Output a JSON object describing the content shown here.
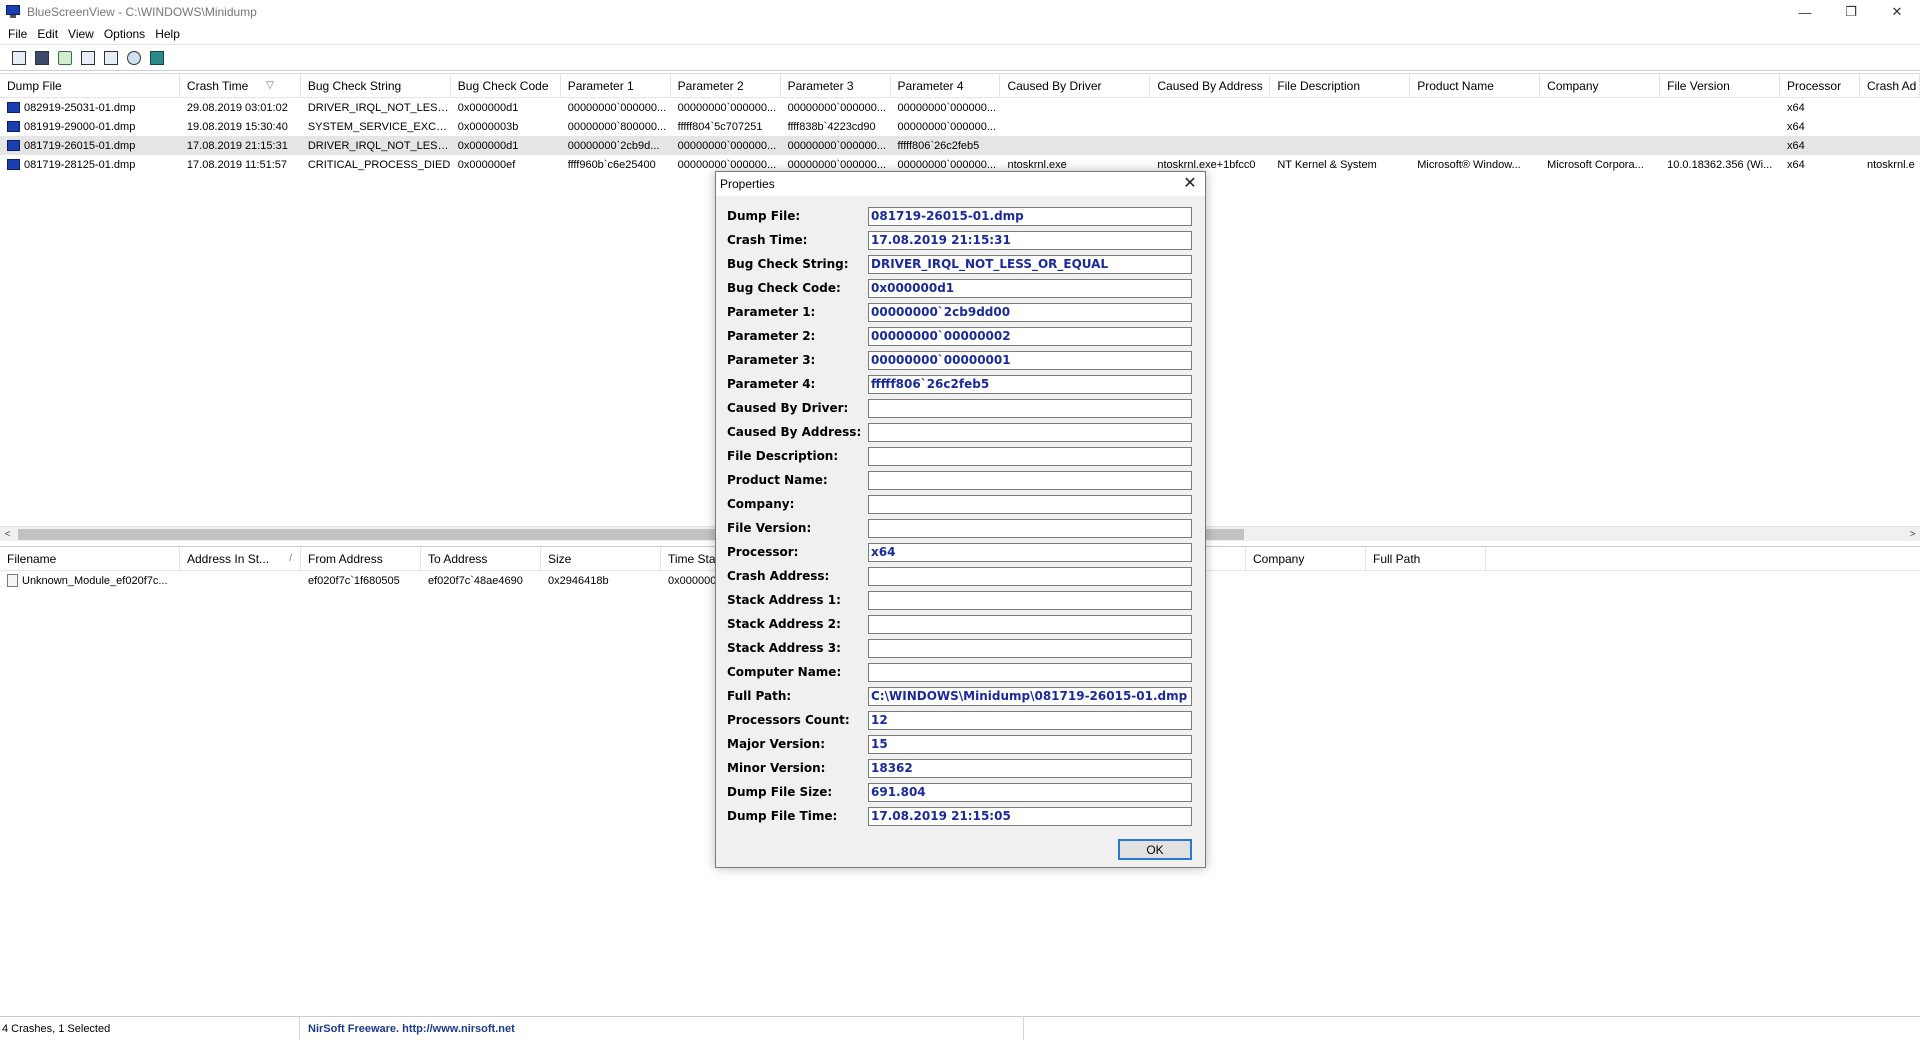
{
  "window": {
    "title": "BlueScreenView  -  C:\\WINDOWS\\Minidump",
    "minimize": "—",
    "restore": "❐",
    "close": "✕"
  },
  "menu": [
    "File",
    "Edit",
    "View",
    "Options",
    "Help"
  ],
  "toolbar_icons": [
    "properties-icon",
    "save-icon",
    "refresh-icon",
    "copy-icon",
    "html-report-icon",
    "find-icon",
    "exit-icon"
  ],
  "top_grid": {
    "columns": [
      "Dump File",
      "Crash Time",
      "Bug Check String",
      "Bug Check Code",
      "Parameter 1",
      "Parameter 2",
      "Parameter 3",
      "Parameter 4",
      "Caused By Driver",
      "Caused By Address",
      "File Description",
      "Product Name",
      "Company",
      "File Version",
      "Processor",
      "Crash Ad"
    ],
    "sort_indicator": "▽",
    "rows": [
      [
        "082919-25031-01.dmp",
        "29.08.2019 03:01:02",
        "DRIVER_IRQL_NOT_LESS...",
        "0x000000d1",
        "00000000`000000...",
        "00000000`000000...",
        "00000000`000000...",
        "00000000`000000...",
        "",
        "",
        "",
        "",
        "",
        "",
        "x64",
        ""
      ],
      [
        "081919-29000-01.dmp",
        "19.08.2019 15:30:40",
        "SYSTEM_SERVICE_EXCEP...",
        "0x0000003b",
        "00000000`800000...",
        "fffff804`5c707251",
        "ffff838b`4223cd90",
        "00000000`000000...",
        "",
        "",
        "",
        "",
        "",
        "",
        "x64",
        ""
      ],
      [
        "081719-26015-01.dmp",
        "17.08.2019 21:15:31",
        "DRIVER_IRQL_NOT_LESS...",
        "0x000000d1",
        "00000000`2cb9d...",
        "00000000`000000...",
        "00000000`000000...",
        "fffff806`26c2feb5",
        "",
        "",
        "",
        "",
        "",
        "",
        "x64",
        ""
      ],
      [
        "081719-28125-01.dmp",
        "17.08.2019 11:51:57",
        "CRITICAL_PROCESS_DIED",
        "0x000000ef",
        "ffff960b`c6e25400",
        "00000000`000000...",
        "00000000`000000...",
        "00000000`000000...",
        "ntoskrnl.exe",
        "ntoskrnl.exe+1bfcc0",
        "NT Kernel & System",
        "Microsoft® Window...",
        "Microsoft Corpora...",
        "10.0.18362.356 (Wi...",
        "x64",
        "ntoskrnl.e"
      ]
    ]
  },
  "scroll": {
    "left": "<",
    "right": ">"
  },
  "bottom_grid": {
    "columns": [
      "Filename",
      "Address In St...",
      "From Address",
      "To Address",
      "Size",
      "Time Stam",
      "",
      "",
      "",
      "",
      "Company",
      "Full Path"
    ],
    "sort_indicator": "/",
    "rows": [
      [
        "Unknown_Module_ef020f7c...",
        "",
        "ef020f7c`1f680505",
        "ef020f7c`48ae4690",
        "0x2946418b",
        "0x000000",
        "",
        "",
        "",
        "",
        "",
        ""
      ]
    ]
  },
  "status": {
    "count": "4 Crashes, 1 Selected",
    "link": "NirSoft Freeware.  http://www.nirsoft.net"
  },
  "dialog": {
    "title": "Properties",
    "close": "✕",
    "ok": "OK",
    "fields": [
      {
        "label": "Dump File:",
        "value": "081719-26015-01.dmp"
      },
      {
        "label": "Crash Time:",
        "value": "17.08.2019 21:15:31"
      },
      {
        "label": "Bug Check String:",
        "value": "DRIVER_IRQL_NOT_LESS_OR_EQUAL"
      },
      {
        "label": "Bug Check Code:",
        "value": "0x000000d1"
      },
      {
        "label": "Parameter 1:",
        "value": "00000000`2cb9dd00"
      },
      {
        "label": "Parameter 2:",
        "value": "00000000`00000002"
      },
      {
        "label": "Parameter 3:",
        "value": "00000000`00000001"
      },
      {
        "label": "Parameter 4:",
        "value": "fffff806`26c2feb5"
      },
      {
        "label": "Caused By Driver:",
        "value": ""
      },
      {
        "label": "Caused By Address:",
        "value": ""
      },
      {
        "label": "File Description:",
        "value": ""
      },
      {
        "label": "Product Name:",
        "value": ""
      },
      {
        "label": "Company:",
        "value": ""
      },
      {
        "label": "File Version:",
        "value": ""
      },
      {
        "label": "Processor:",
        "value": "x64"
      },
      {
        "label": "Crash Address:",
        "value": ""
      },
      {
        "label": "Stack Address 1:",
        "value": ""
      },
      {
        "label": "Stack Address 2:",
        "value": ""
      },
      {
        "label": "Stack Address 3:",
        "value": ""
      },
      {
        "label": "Computer Name:",
        "value": ""
      },
      {
        "label": "Full Path:",
        "value": "C:\\WINDOWS\\Minidump\\081719-26015-01.dmp"
      },
      {
        "label": "Processors Count:",
        "value": "12"
      },
      {
        "label": "Major Version:",
        "value": "15"
      },
      {
        "label": "Minor Version:",
        "value": "18362"
      },
      {
        "label": "Dump File Size:",
        "value": "691.804"
      },
      {
        "label": "Dump File Time:",
        "value": "17.08.2019 21:15:05"
      }
    ]
  }
}
